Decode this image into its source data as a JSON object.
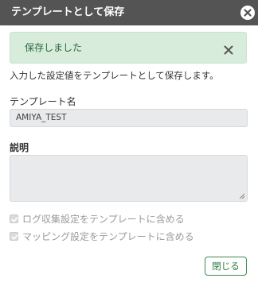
{
  "dialog": {
    "title": "テンプレートとして保存",
    "close_icon": "close-circle-icon"
  },
  "alert": {
    "message": "保存しました",
    "close_icon": "close-icon",
    "colors": {
      "background": "#d7ecdb",
      "text": "#2d6a3b"
    }
  },
  "description": "入力した設定値をテンプレートとして保存します。",
  "form": {
    "template_name_label": "テンプレート名",
    "template_name_value": "AMIYA_TEST",
    "description_label": "説明",
    "description_value": "",
    "options": [
      {
        "label": "ログ収集設定をテンプレートに含める",
        "checked": true,
        "disabled": true
      },
      {
        "label": "マッピング設定をテンプレートに含める",
        "checked": true,
        "disabled": true
      }
    ]
  },
  "footer": {
    "close_label": "閉じる",
    "accent": "#3d8b4f"
  }
}
